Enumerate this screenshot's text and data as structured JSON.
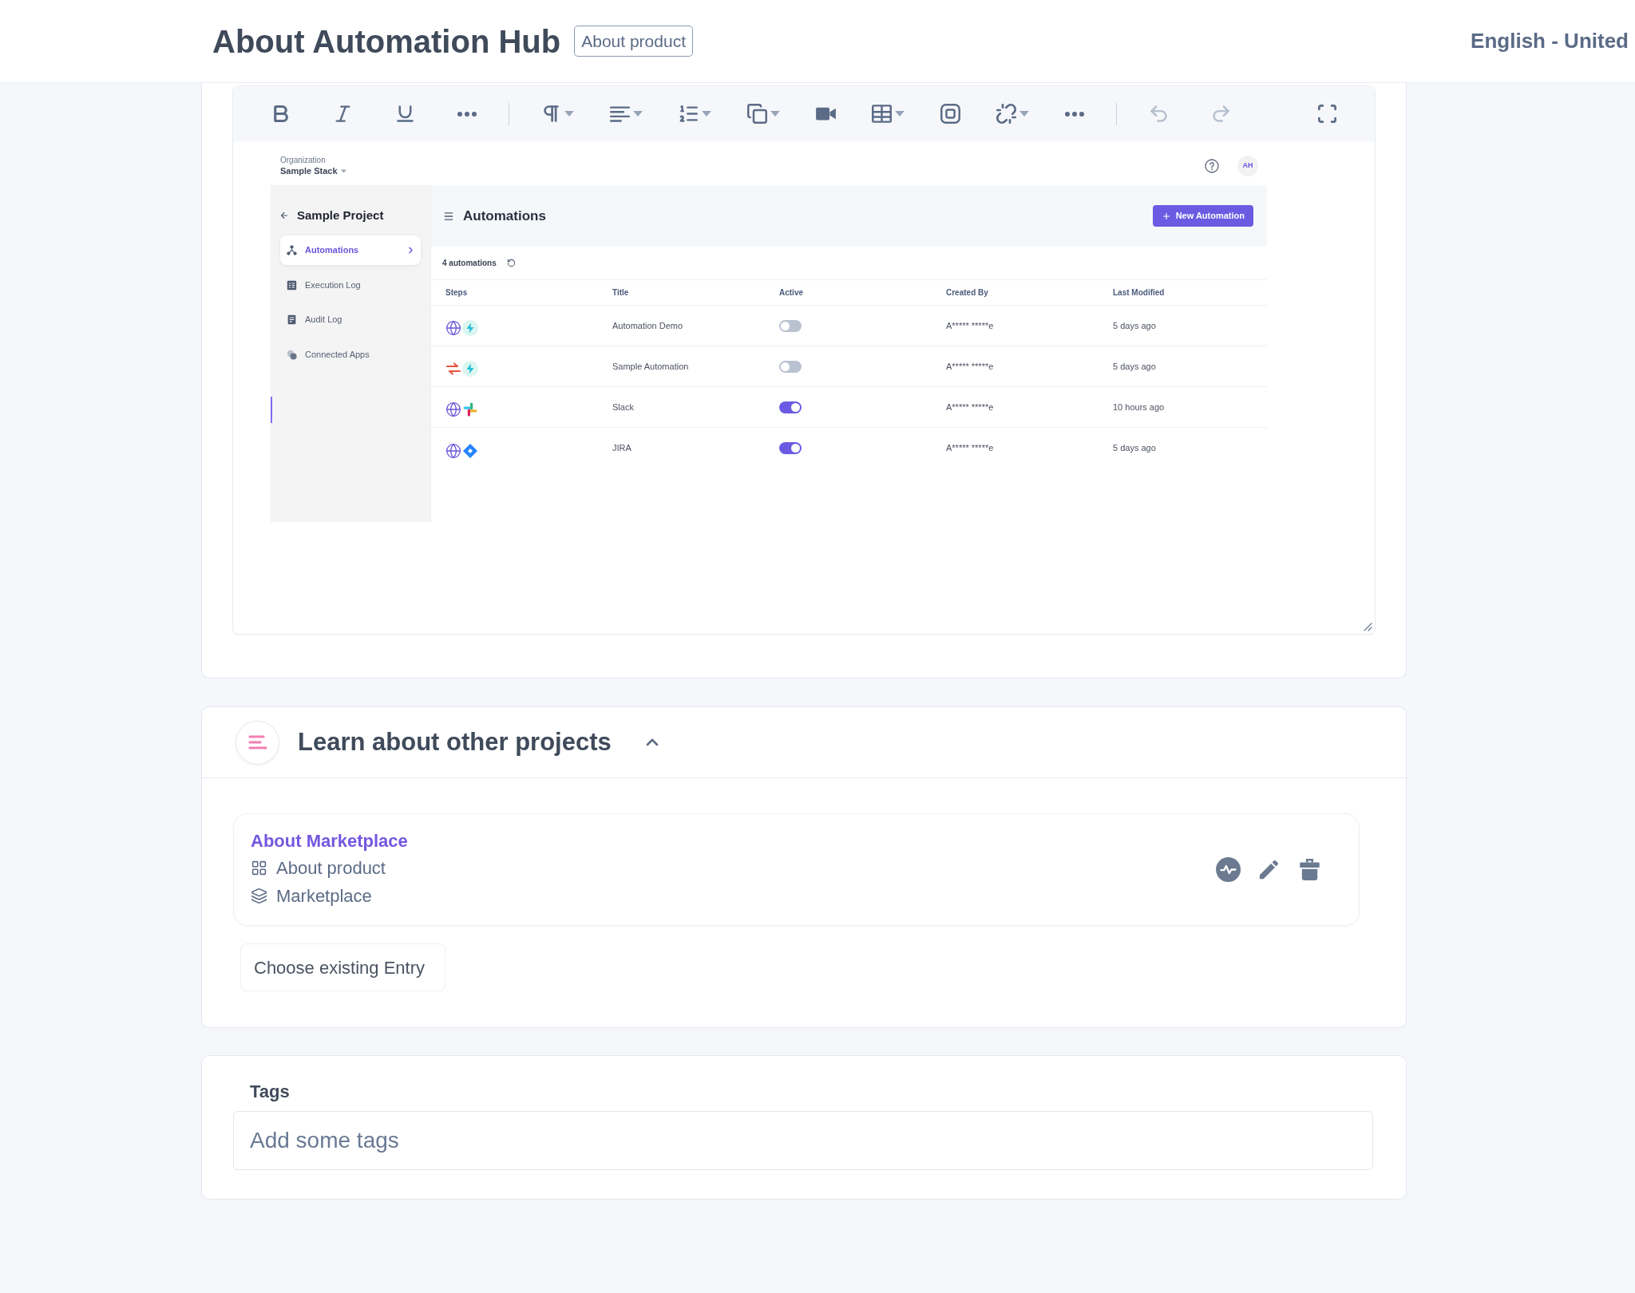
{
  "header": {
    "title": "About Automation Hub",
    "badge": "About product",
    "language": "English - United"
  },
  "editor": {
    "toolbar": {
      "groups": [
        [
          {
            "kind": "bold",
            "disabled": false
          },
          {
            "kind": "italic",
            "disabled": false
          },
          {
            "kind": "underline",
            "disabled": false
          },
          {
            "kind": "more",
            "disabled": false
          }
        ],
        [
          {
            "kind": "paragraph",
            "disabled": false
          },
          {
            "kind": "align",
            "disabled": false
          },
          {
            "kind": "list",
            "disabled": false
          },
          {
            "kind": "copy",
            "disabled": false
          },
          {
            "kind": "video",
            "disabled": false
          },
          {
            "kind": "table",
            "disabled": false
          },
          {
            "kind": "embed",
            "disabled": false
          },
          {
            "kind": "link",
            "disabled": false
          },
          {
            "kind": "more",
            "disabled": false
          }
        ],
        [
          {
            "kind": "undo",
            "disabled": true
          },
          {
            "kind": "redo",
            "disabled": true
          }
        ]
      ],
      "end": [
        {
          "kind": "fullscreen",
          "disabled": false
        }
      ]
    },
    "screenshot": {
      "organization_label": "Organization",
      "organization": "Sample Stack",
      "avatar": "AH",
      "project": "Sample Project",
      "nav": [
        {
          "kind": "flow",
          "label": "Automations",
          "selected": true
        },
        {
          "kind": "table",
          "label": "Execution Log",
          "selected": false
        },
        {
          "kind": "document",
          "label": "Audit Log",
          "selected": false
        },
        {
          "kind": "apps",
          "label": "Connected Apps",
          "selected": false
        }
      ],
      "page_title": "Automations",
      "new_button": "New Automation",
      "count": "4 automations",
      "columns": [
        "Steps",
        "Title",
        "Active",
        "Created By",
        "Last Modified"
      ],
      "rows": [
        {
          "steps": [
            {
              "kind": "globe"
            },
            {
              "kind": "bolt"
            }
          ],
          "title": "Automation Demo",
          "active": false,
          "created_by": "A***** *****e",
          "last_modified": "5 days ago"
        },
        {
          "steps": [
            {
              "kind": "arrows"
            },
            {
              "kind": "bolt"
            }
          ],
          "title": "Sample Automation",
          "active": false,
          "created_by": "A***** *****e",
          "last_modified": "5 days ago"
        },
        {
          "steps": [
            {
              "kind": "globe"
            },
            {
              "kind": "hash"
            }
          ],
          "title": "Slack",
          "active": true,
          "created_by": "A***** *****e",
          "last_modified": "10 hours ago"
        },
        {
          "steps": [
            {
              "kind": "globe"
            },
            {
              "kind": "diamond"
            }
          ],
          "title": "JIRA",
          "active": true,
          "created_by": "A***** *****e",
          "last_modified": "5 days ago"
        }
      ]
    }
  },
  "related_projects": {
    "title": "Learn about other projects",
    "expanded": true,
    "entries": [
      {
        "title": "About Marketplace",
        "type": "About product",
        "category": "Marketplace"
      }
    ],
    "choose_button": "Choose existing Entry"
  },
  "tags": {
    "label": "Tags",
    "placeholder": "Add some tags"
  }
}
